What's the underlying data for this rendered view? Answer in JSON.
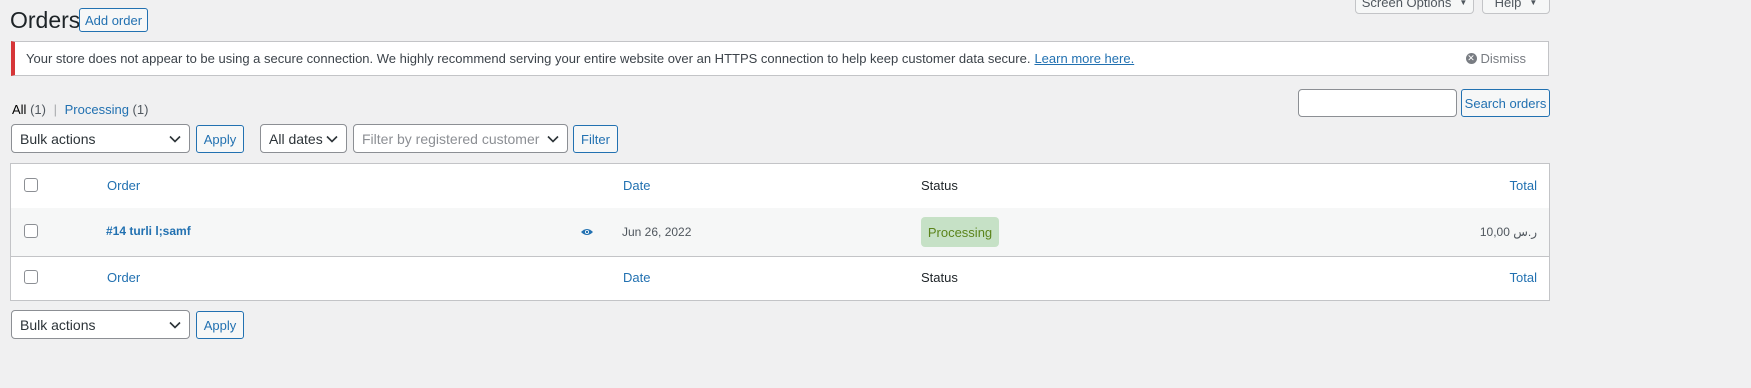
{
  "header": {
    "title": "Orders",
    "add_order_label": "Add order",
    "screen_options_label": "Screen Options",
    "help_label": "Help"
  },
  "notice": {
    "message": "Your store does not appear to be using a secure connection. We highly recommend serving your entire website over an HTTPS connection to help keep customer data secure.",
    "link_text": "Learn more here.",
    "dismiss_label": "Dismiss"
  },
  "views": {
    "all_label": "All",
    "all_count": "(1)",
    "separator": "|",
    "processing_label": "Processing",
    "processing_count": "(1)"
  },
  "search": {
    "value": "",
    "button_label": "Search orders"
  },
  "filters": {
    "bulk_actions_label": "Bulk actions",
    "apply_label": "Apply",
    "dates_label": "All dates",
    "customer_placeholder": "Filter by registered customer",
    "filter_label": "Filter"
  },
  "table": {
    "columns": {
      "order": "Order",
      "date": "Date",
      "status": "Status",
      "total": "Total"
    },
    "rows": [
      {
        "order": "#14 turli l;samf",
        "date": "Jun 26, 2022",
        "status": "Processing",
        "total": "10,00 ر.س"
      }
    ]
  },
  "bottom": {
    "bulk_actions_label": "Bulk actions",
    "apply_label": "Apply"
  },
  "colors": {
    "accent": "#2271b1",
    "notice_border": "#d63638",
    "status_processing_bg": "#c6e1c6",
    "status_processing_text": "#5b841b"
  }
}
